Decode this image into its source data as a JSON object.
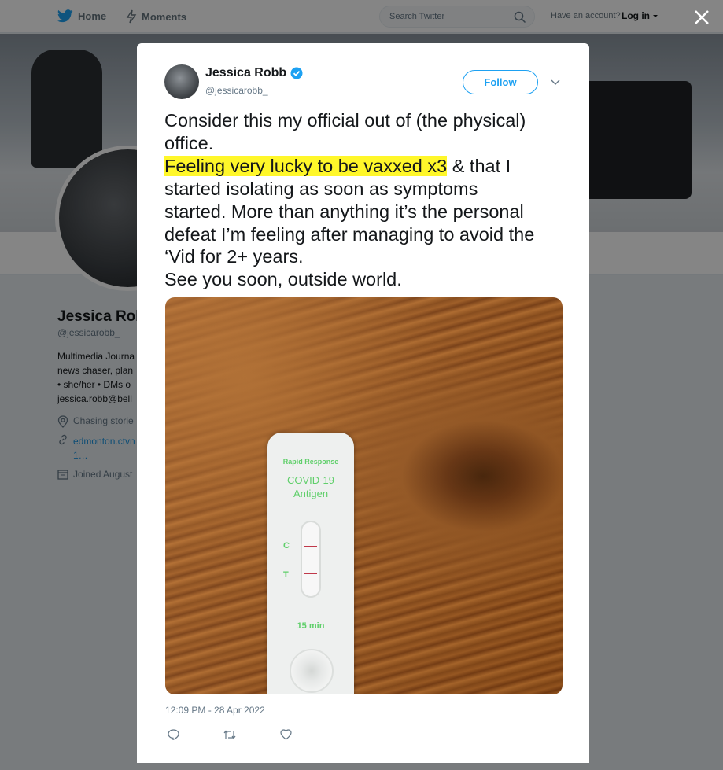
{
  "nav": {
    "home": "Home",
    "moments": "Moments",
    "search_placeholder": "Search Twitter",
    "account_prompt": "Have an account?",
    "login": "Log in"
  },
  "profile": {
    "name": "Jessica Robb",
    "handle": "@jessicarobb_",
    "bio_lines": [
      "Multimedia Journa",
      "news chaser, plan",
      "• she/her • DMs o",
      "jessica.robb@bell"
    ],
    "location": "Chasing storie",
    "url_line1": "edmonton.ctvn",
    "url_line2": "1…",
    "joined": "Joined August"
  },
  "tweet": {
    "name": "Jessica Robb",
    "handle": "@jessicarobb_",
    "follow_label": "Follow",
    "line1": "Consider this my official out of (the physical)",
    "line2": "office.",
    "highlight": "Feeling very lucky to be vaxxed x3",
    "line3_rest": " & that I",
    "line4": "started isolating as soon as symptoms",
    "line5": "started. More than anything it’s the personal",
    "line6": "defeat I’m feeling after managing to avoid the",
    "line7": "‘Vid for 2+ years.",
    "line8": "See you soon, outside world.",
    "timestamp": "12:09 PM - 28 Apr 2022"
  },
  "photo": {
    "brand": "Rapid Response",
    "test_line1": "COVID-19",
    "test_line2": "Antigen",
    "c_label": "C",
    "t_label": "T",
    "duration": "15 min"
  },
  "colors": {
    "accent": "#1da1f2",
    "highlight": "#fff72a",
    "verified": "#1da1f2"
  }
}
